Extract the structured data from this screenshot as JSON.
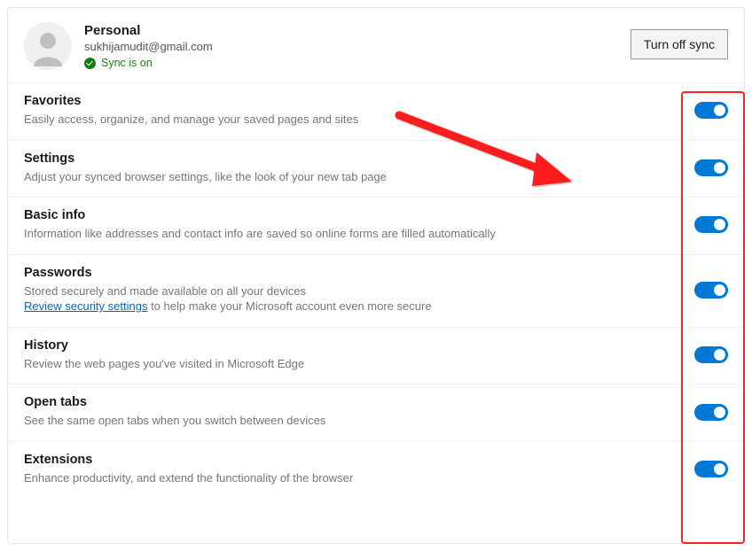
{
  "profile": {
    "name": "Personal",
    "email": "sukhijamudit@gmail.com",
    "sync_status": "Sync is on",
    "turn_off_label": "Turn off sync"
  },
  "items": [
    {
      "title": "Favorites",
      "desc": "Easily access, organize, and manage your saved pages and sites",
      "link": null,
      "after": ""
    },
    {
      "title": "Settings",
      "desc": "Adjust your synced browser settings, like the look of your new tab page",
      "link": null,
      "after": ""
    },
    {
      "title": "Basic info",
      "desc": "Information like addresses and contact info are saved so online forms are filled automatically",
      "link": null,
      "after": ""
    },
    {
      "title": "Passwords",
      "desc": "Stored securely and made available on all your devices",
      "link": "Review security settings",
      "after": " to help make your Microsoft account even more secure"
    },
    {
      "title": "History",
      "desc": "Review the web pages you've visited in Microsoft Edge",
      "link": null,
      "after": ""
    },
    {
      "title": "Open tabs",
      "desc": "See the same open tabs when you switch between devices",
      "link": null,
      "after": ""
    },
    {
      "title": "Extensions",
      "desc": "Enhance productivity, and extend the functionality of the browser",
      "link": null,
      "after": ""
    }
  ],
  "colors": {
    "accent": "#0078d4",
    "highlight": "#ff2222"
  }
}
